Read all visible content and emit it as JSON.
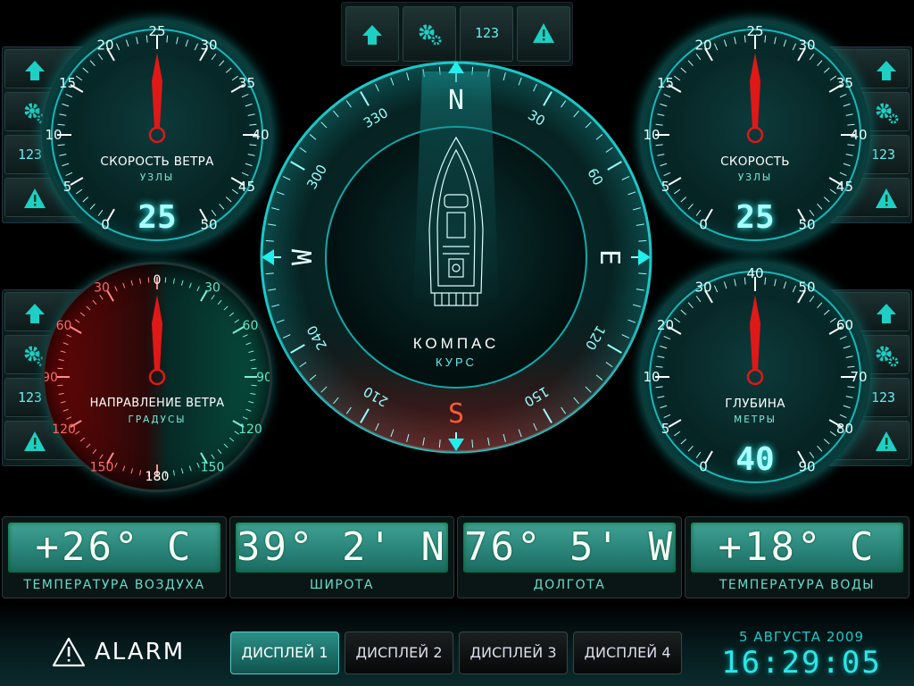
{
  "colors": {
    "accent": "#19d6cf",
    "alarm": "#e02020",
    "background": "#000000",
    "lcd": "#2f8b80"
  },
  "top_buttons": [
    {
      "name": "arrow-up-icon"
    },
    {
      "name": "gear-icon"
    },
    {
      "label": "123"
    },
    {
      "name": "warning-icon"
    }
  ],
  "side_buttons": {
    "label_123": "123"
  },
  "gauges": {
    "wind_speed": {
      "title": "СКОРОСТЬ ВЕТРА",
      "unit": "УЗЛЫ",
      "value": "25",
      "ticks": [
        "0",
        "5",
        "10",
        "15",
        "20",
        "25",
        "30",
        "35",
        "40",
        "45",
        "50"
      ]
    },
    "speed": {
      "title": "СКОРОСТЬ",
      "unit": "УЗЛЫ",
      "value": "25",
      "ticks": [
        "0",
        "5",
        "10",
        "15",
        "20",
        "25",
        "30",
        "35",
        "40",
        "45",
        "50"
      ]
    },
    "wind_direction": {
      "title": "НАПРАВЛЕНИЕ ВЕТРА",
      "unit": "ГРАДУСЫ",
      "top": "0",
      "bottom": "180",
      "left_ticks": [
        "30",
        "60",
        "90",
        "120",
        "150"
      ],
      "right_ticks": [
        "30",
        "60",
        "90",
        "120",
        "150"
      ]
    },
    "depth": {
      "title": "ГЛУБИНА",
      "unit": "МЕТРЫ",
      "value": "40",
      "ticks": [
        "0",
        "5",
        "10",
        "20",
        "30",
        "40",
        "50",
        "60",
        "70",
        "80",
        "90"
      ]
    }
  },
  "compass": {
    "title": "КОМПАС",
    "subtitle": "КУРС",
    "cardinals": {
      "n": "N",
      "e": "E",
      "s": "S",
      "w": "W"
    },
    "degrees": [
      "30",
      "60",
      "120",
      "150",
      "210",
      "240",
      "300",
      "330"
    ]
  },
  "panels": [
    {
      "value": "+26° C",
      "label": "ТЕМПЕРАТУРА ВОЗДУХА"
    },
    {
      "value": "39° 2' N",
      "label": "ШИРОТА"
    },
    {
      "value": "76° 5' W",
      "label": "ДОЛГОТА"
    },
    {
      "value": "+18° C",
      "label": "ТЕМПЕРАТУРА ВОДЫ"
    }
  ],
  "bottom": {
    "alarm": "ALARM",
    "displays": [
      "ДИСПЛЕЙ 1",
      "ДИСПЛЕЙ 2",
      "ДИСПЛЕЙ 3",
      "ДИСПЛЕЙ 4"
    ],
    "active_display": 0,
    "date": "5 АВГУСТА 2009",
    "time": "16:29:05"
  }
}
